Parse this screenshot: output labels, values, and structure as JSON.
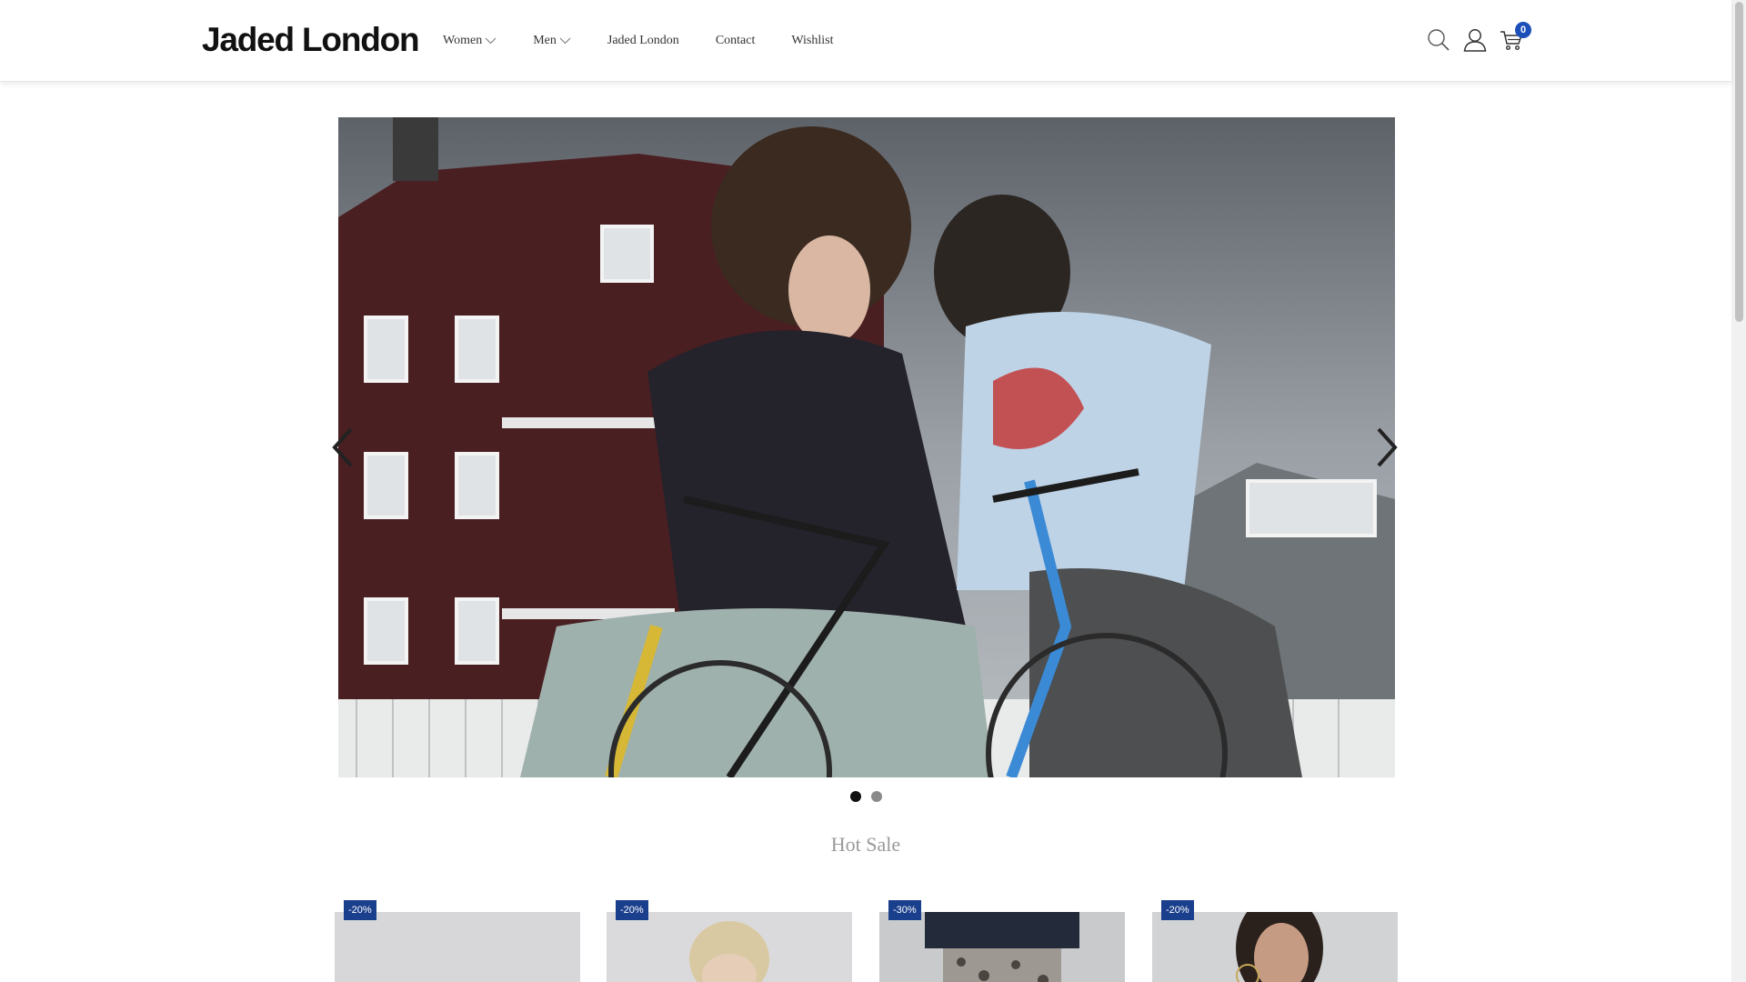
{
  "brand": {
    "logo_text": "Jaded London"
  },
  "nav": {
    "items": [
      {
        "label": "Women",
        "has_dropdown": true
      },
      {
        "label": "Men",
        "has_dropdown": true
      },
      {
        "label": "Jaded London",
        "has_dropdown": false
      },
      {
        "label": "Contact",
        "has_dropdown": false
      },
      {
        "label": "Wishlist",
        "has_dropdown": false
      }
    ]
  },
  "header_icons": {
    "search": "search-icon",
    "account": "user-icon",
    "cart": "cart-icon",
    "cart_count": "0"
  },
  "hero": {
    "slide_count": 2,
    "active_slide": 1
  },
  "sections": {
    "hot_sale_title": "Hot Sale"
  },
  "products": [
    {
      "discount": "-20%"
    },
    {
      "discount": "-20%"
    },
    {
      "discount": "-30%"
    },
    {
      "discount": "-20%"
    }
  ],
  "colors": {
    "badge_blue": "#1d4fb8",
    "discount_blue": "#1a3f8c",
    "text": "#333333",
    "section_title": "#999999"
  }
}
